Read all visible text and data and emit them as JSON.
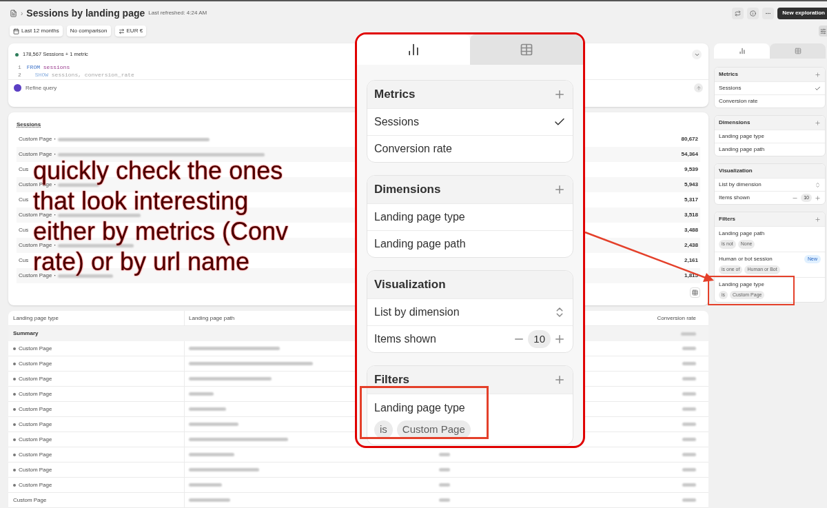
{
  "header": {
    "separator": "›",
    "title": "Sessions by landing page",
    "last_refreshed": "Last refreshed: 4:24 AM",
    "new_button": "New exploration"
  },
  "chips": [
    {
      "kind": "date",
      "label": "Last 12 months"
    },
    {
      "kind": "plain",
      "label": "No comparison"
    },
    {
      "kind": "currency",
      "label": "EUR €"
    }
  ],
  "query": {
    "summary": "178,567 Sessions + 1 metric",
    "lines": [
      {
        "number": "1",
        "tokens": [
          {
            "kind": "keyword",
            "text": "FROM"
          },
          {
            "kind": "name",
            "text": "sessions"
          }
        ]
      },
      {
        "number": "2",
        "tokens": [
          {
            "kind": "keyword",
            "text": "SHOW"
          },
          {
            "kind": "plain",
            "text": "sessions, conversion_rate"
          }
        ]
      }
    ],
    "refine": "Refine query"
  },
  "sessions_list": {
    "title": "Sessions",
    "separator": "·",
    "rows": [
      {
        "kind": "full",
        "label": "Custom Page",
        "value": "80,672"
      },
      {
        "kind": "full",
        "label": "Custom Page",
        "value": "54,364"
      },
      {
        "kind": "covered",
        "label": "Cus",
        "value": "9,539"
      },
      {
        "kind": "full",
        "label": "Custom Page",
        "value": "5,943"
      },
      {
        "kind": "covered",
        "label": "Cus",
        "value": "5,317"
      },
      {
        "kind": "full",
        "label": "Custom Page",
        "value": "3,518"
      },
      {
        "kind": "covered",
        "label": "Cus",
        "value": "3,488"
      },
      {
        "kind": "full",
        "label": "Custom Page",
        "value": "2,438"
      },
      {
        "kind": "covered",
        "label": "Cus",
        "value": "2,161"
      },
      {
        "kind": "full",
        "label": "Custom Page",
        "value": "1,815"
      }
    ]
  },
  "table": {
    "columns": [
      "Landing page type",
      "Landing page path",
      "Conversion rate"
    ],
    "summary": "Summary",
    "rows": [
      {
        "type": "Custom Page",
        "marker": true
      },
      {
        "type": "Custom Page",
        "marker": true
      },
      {
        "type": "Custom Page",
        "marker": true
      },
      {
        "type": "Custom Page",
        "marker": true
      },
      {
        "type": "Custom Page",
        "marker": true
      },
      {
        "type": "Custom Page",
        "marker": true
      },
      {
        "type": "Custom Page",
        "marker": true
      },
      {
        "type": "Custom Page",
        "marker": true
      },
      {
        "type": "Custom Page",
        "marker": true
      },
      {
        "type": "Custom Page",
        "marker": true
      },
      {
        "type": "Custom Page",
        "marker": false
      }
    ]
  },
  "sidebar": {
    "tabs": [
      {
        "kind": "chart",
        "selected": true
      },
      {
        "kind": "table",
        "selected": false
      }
    ],
    "sections": [
      {
        "kind": "list",
        "title": "Metrics",
        "addable": true,
        "items": [
          {
            "label": "Sessions",
            "checked": true
          },
          {
            "label": "Conversion rate",
            "checked": false
          }
        ]
      },
      {
        "kind": "list",
        "title": "Dimensions",
        "addable": true,
        "items": [
          {
            "label": "Landing page type",
            "checked": false
          },
          {
            "label": "Landing page path",
            "checked": false
          }
        ]
      },
      {
        "kind": "visualization",
        "title": "Visualization",
        "addable": false,
        "select": "List by dimension",
        "items_label": "Items shown",
        "items_value": "10"
      },
      {
        "kind": "filters",
        "title": "Filters",
        "addable": true,
        "filters": [
          {
            "field": "Landing page path",
            "operator": "is not",
            "value": "None",
            "highlighted": false
          },
          {
            "field": "Human or bot session",
            "badge": "New",
            "operator": "is one of",
            "value": "Human or Bot",
            "highlighted": false
          },
          {
            "field": "Landing page type",
            "operator": "is",
            "value": "Custom Page",
            "highlighted": true
          }
        ]
      }
    ]
  },
  "zoomed_sidebar": {
    "tabs": [
      {
        "kind": "chart",
        "selected": true
      },
      {
        "kind": "table",
        "selected": false
      }
    ],
    "sections": [
      {
        "kind": "list",
        "title": "Metrics",
        "addable": true,
        "items": [
          {
            "label": "Sessions",
            "checked": true
          },
          {
            "label": "Conversion rate",
            "checked": false
          }
        ]
      },
      {
        "kind": "list",
        "title": "Dimensions",
        "addable": true,
        "items": [
          {
            "label": "Landing page type",
            "checked": false
          },
          {
            "label": "Landing page path",
            "checked": false
          }
        ]
      },
      {
        "kind": "visualization",
        "title": "Visualization",
        "addable": false,
        "select": "List by dimension",
        "items_label": "Items shown",
        "items_value": "10"
      },
      {
        "kind": "filters",
        "title": "Filters",
        "addable": true,
        "filters": [
          {
            "field": "Landing page type",
            "operator": "is",
            "value": "Custom Page",
            "highlighted": true
          }
        ]
      }
    ]
  },
  "annotation": {
    "lines": [
      "quickly check the ones",
      "that look interesting",
      "either by metrics (Conv",
      "rate) or by url name"
    ]
  }
}
